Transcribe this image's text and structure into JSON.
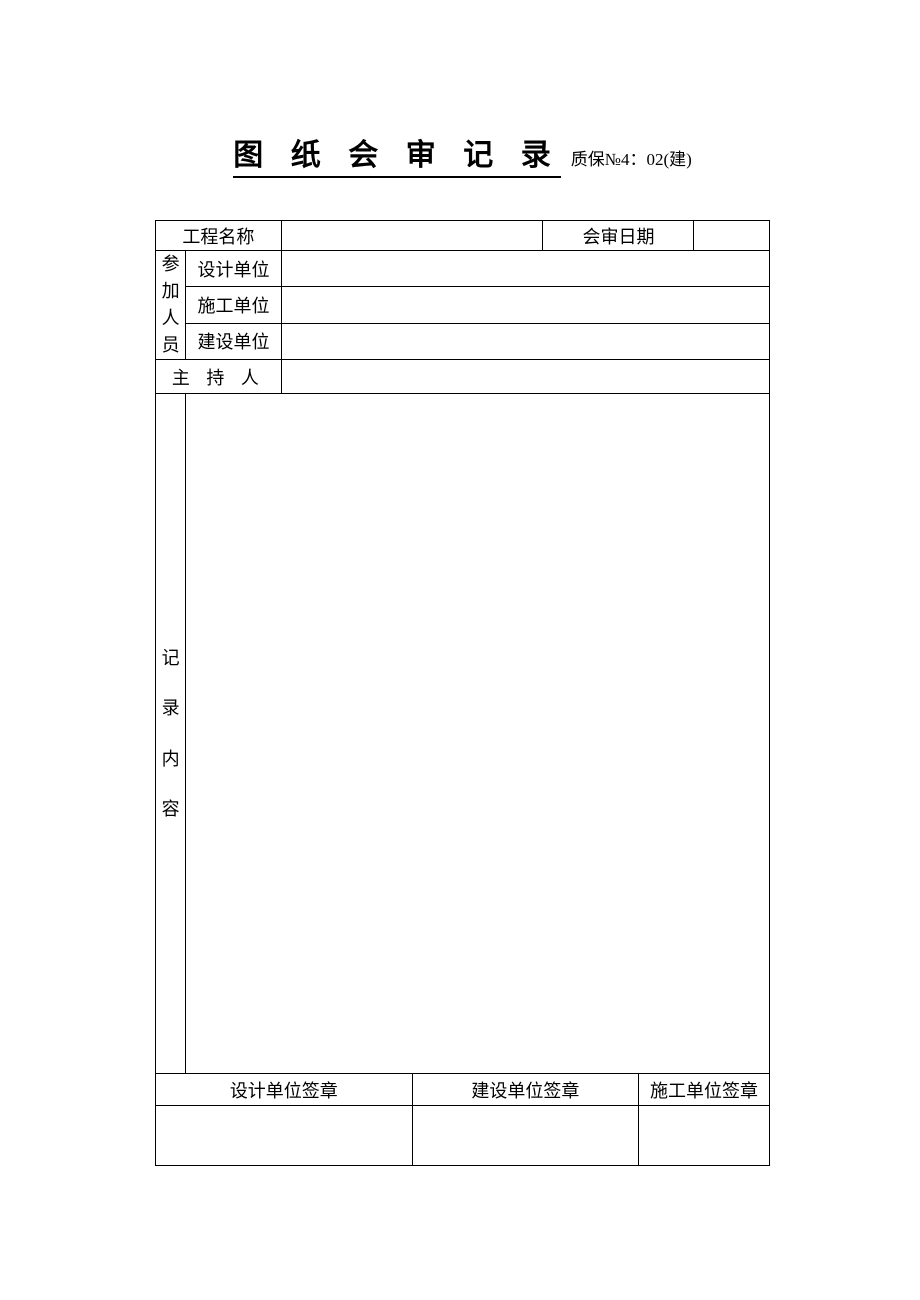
{
  "header": {
    "title": "图 纸 会 审 记 录",
    "suffix": "质保№4：02(建)"
  },
  "labels": {
    "project_name": "工程名称",
    "review_date": "会审日期",
    "participants": "参加人员",
    "design_unit": "设计单位",
    "construction_unit": "施工单位",
    "build_unit": "建设单位",
    "host": "主 持 人",
    "record_content": "记录内容",
    "sig_design": "设计单位签章",
    "sig_build": "建设单位签章",
    "sig_construction": "施工单位签章"
  },
  "values": {
    "project_name": "",
    "review_date": "",
    "design_unit": "",
    "construction_unit": "",
    "build_unit": "",
    "host": "",
    "record_content": "",
    "sig_design": "",
    "sig_build": "",
    "sig_construction": ""
  }
}
